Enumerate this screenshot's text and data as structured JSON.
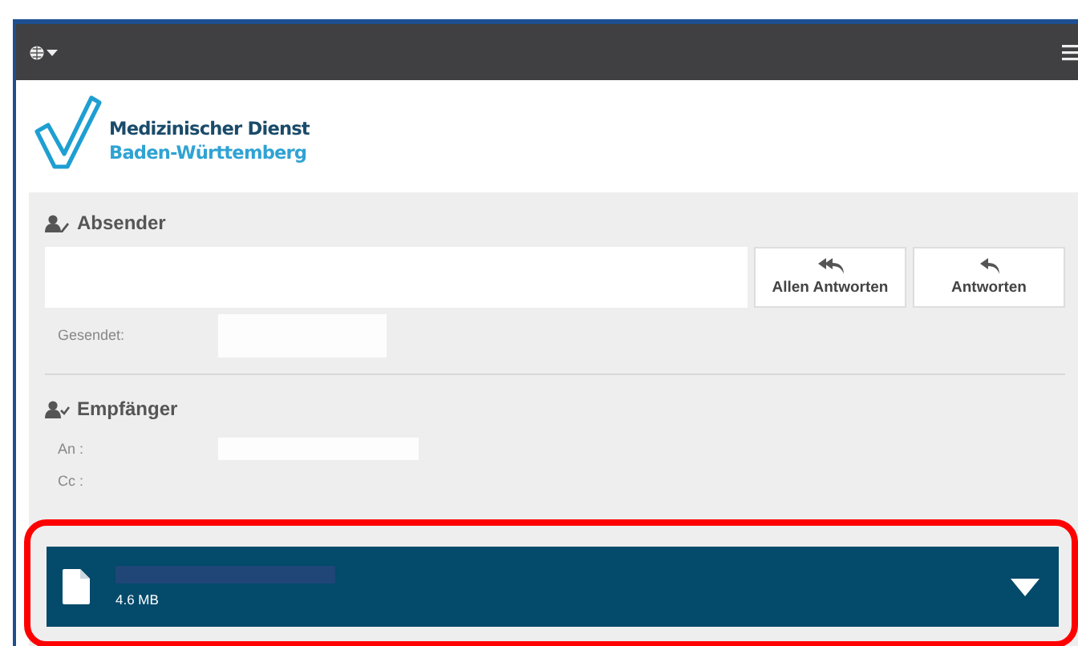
{
  "top_bar": {
    "language_menu": true,
    "main_menu": true
  },
  "logo": {
    "line_1": "Medizinischer Dienst",
    "line_2": "Baden-Württemberg"
  },
  "sender": {
    "title": "Absender",
    "actions": [
      {
        "kind": "reply_all",
        "label": "Allen Antworten"
      },
      {
        "kind": "reply",
        "label": "Antworten"
      }
    ],
    "fields": [
      {
        "label": "Gesendet:",
        "redacted": true
      }
    ]
  },
  "recipient": {
    "title": "Empfänger",
    "fields": [
      {
        "label": "An :",
        "redacted": true
      },
      {
        "label": "Cc :"
      }
    ]
  },
  "attachment": {
    "size": "4.6 MB",
    "name_redacted": true,
    "highlighted": true
  }
}
